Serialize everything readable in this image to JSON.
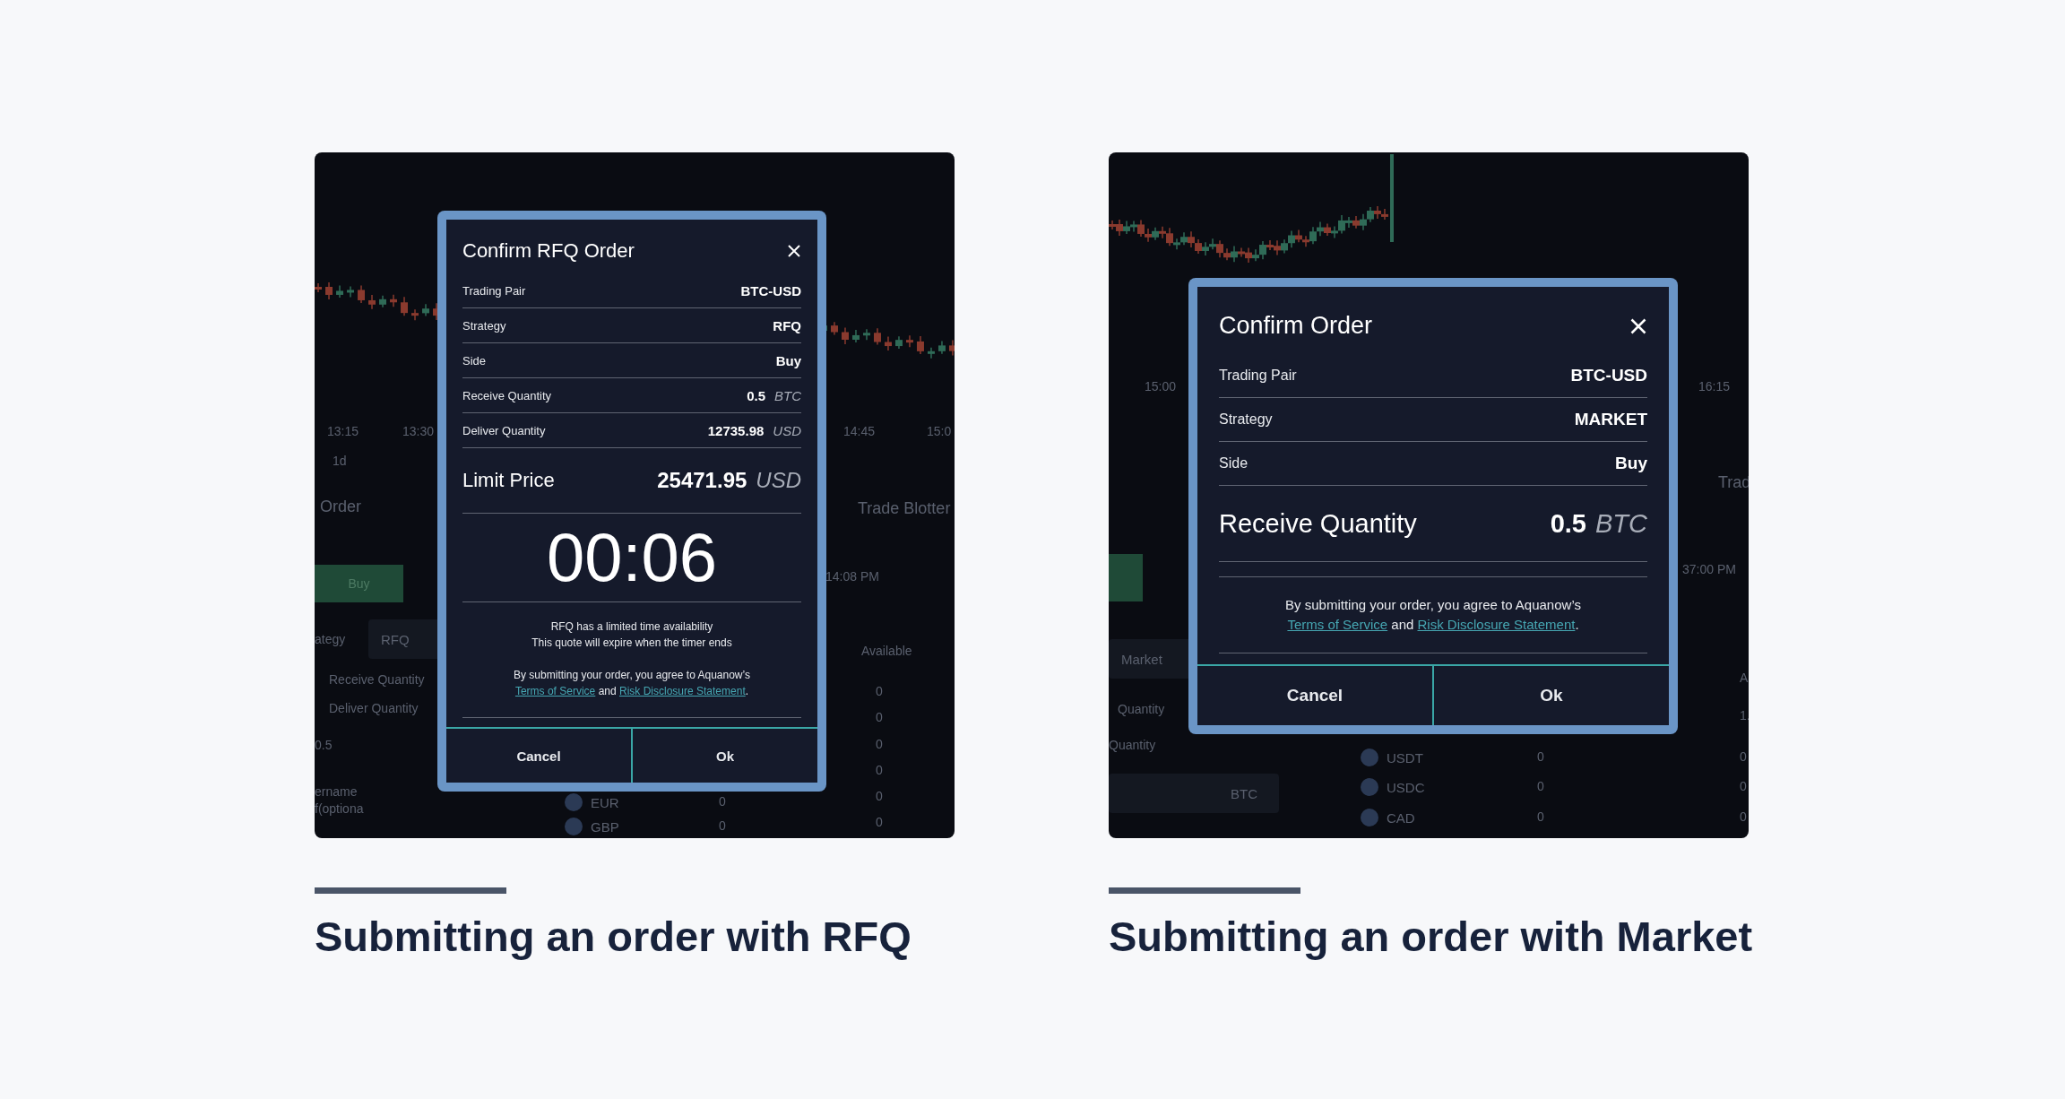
{
  "panels": [
    {
      "backdrop": [
        {
          "kind": "label",
          "text": "13:15"
        },
        {
          "kind": "label",
          "text": "13:30"
        },
        {
          "kind": "label",
          "text": "14:45"
        },
        {
          "kind": "label",
          "text": "15:0"
        },
        {
          "kind": "label",
          "text": "1d"
        },
        {
          "kind": "heading",
          "text": "Order"
        },
        {
          "kind": "heading",
          "text": "Trade Blotter"
        },
        {
          "kind": "button",
          "text": "Buy"
        },
        {
          "kind": "label",
          "text": "14:08 PM"
        },
        {
          "kind": "label",
          "text": "ategy"
        },
        {
          "kind": "field",
          "text": "RFQ"
        },
        {
          "kind": "label",
          "text": "Receive Quantity"
        },
        {
          "kind": "label",
          "text": "Deliver Quantity"
        },
        {
          "kind": "label",
          "text": "0.5"
        },
        {
          "kind": "label",
          "text": "ername"
        },
        {
          "kind": "label",
          "text": "f(optiona"
        },
        {
          "kind": "label",
          "text": "Available"
        },
        {
          "kind": "label",
          "text": "0"
        },
        {
          "kind": "label",
          "text": "0"
        },
        {
          "kind": "label",
          "text": "0"
        },
        {
          "kind": "label",
          "text": "0"
        },
        {
          "kind": "label",
          "text": "0"
        },
        {
          "kind": "label",
          "text": "0"
        },
        {
          "kind": "coin",
          "text": "EUR"
        },
        {
          "kind": "coin",
          "text": "GBP"
        },
        {
          "kind": "label",
          "text": "0"
        },
        {
          "kind": "label",
          "text": "0"
        }
      ],
      "modal": {
        "title": "Confirm RFQ Order",
        "rows": [
          {
            "label": "Trading Pair",
            "value": "BTC-USD"
          },
          {
            "label": "Strategy",
            "value": "RFQ"
          },
          {
            "label": "Side",
            "value": "Buy"
          },
          {
            "label": "Receive Quantity",
            "value": "0.5",
            "unit": "BTC"
          },
          {
            "label": "Deliver Quantity",
            "value": "12735.98",
            "unit": "USD"
          }
        ],
        "highlight": {
          "label": "Limit Price",
          "value": "25471.95",
          "unit": "USD"
        },
        "timer": "00:06",
        "notice": [
          "RFQ has a limited time availability",
          "This quote will expire when the timer ends"
        ],
        "agreement": {
          "text": "By submitting your order, you agree to Aquanow’s",
          "links": [
            "Terms of Service",
            "Risk Disclosure Statement"
          ],
          "joiner": "and",
          "end": "."
        },
        "buttons": [
          "Cancel",
          "Ok"
        ]
      },
      "caption": "Submitting an order with RFQ"
    },
    {
      "backdrop": [
        {
          "kind": "label",
          "text": "15:00"
        },
        {
          "kind": "label",
          "text": "16:15"
        },
        {
          "kind": "heading",
          "text": "Trad"
        },
        {
          "kind": "label",
          "text": "37:00 PM"
        },
        {
          "kind": "button"
        },
        {
          "kind": "field",
          "text": "Market"
        },
        {
          "kind": "label",
          "text": "Quantity"
        },
        {
          "kind": "label",
          "text": "Quantity"
        },
        {
          "kind": "field",
          "text": "BTC"
        },
        {
          "kind": "coin",
          "text": "USDT"
        },
        {
          "kind": "coin",
          "text": "USDC"
        },
        {
          "kind": "coin",
          "text": "CAD"
        },
        {
          "kind": "label",
          "text": "0"
        },
        {
          "kind": "label",
          "text": "0"
        },
        {
          "kind": "label",
          "text": "0"
        },
        {
          "kind": "label",
          "text": "A"
        },
        {
          "kind": "label",
          "text": "1."
        },
        {
          "kind": "label",
          "text": "0"
        },
        {
          "kind": "label",
          "text": "0"
        },
        {
          "kind": "label",
          "text": "0"
        }
      ],
      "modal": {
        "title": "Confirm Order",
        "rows": [
          {
            "label": "Trading Pair",
            "value": "BTC-USD"
          },
          {
            "label": "Strategy",
            "value": "MARKET"
          },
          {
            "label": "Side",
            "value": "Buy"
          }
        ],
        "highlight": {
          "label": "Receive Quantity",
          "value": "0.5",
          "unit": "BTC"
        },
        "agreement": {
          "text": "By submitting your order, you agree to Aquanow’s",
          "links": [
            "Terms of Service",
            "Risk Disclosure Statement"
          ],
          "joiner": "and",
          "end": "."
        },
        "buttons": [
          "Cancel",
          "Ok"
        ]
      },
      "caption": "Submitting an order with Market"
    }
  ]
}
